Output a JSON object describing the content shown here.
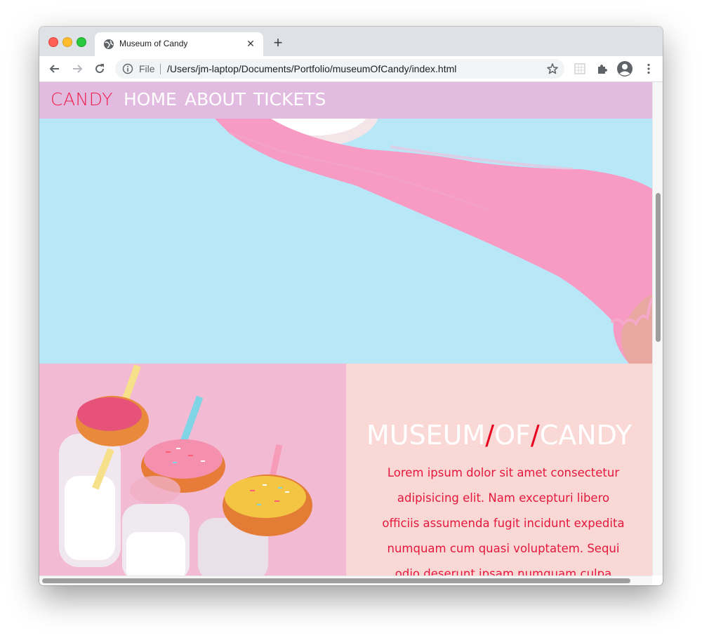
{
  "browser": {
    "tab_title": "Museum of Candy",
    "tab_close": "✕",
    "new_tab": "+",
    "url_scheme": "File",
    "url": "/Users/jm-laptop/Documents/Portfolio/museumOfCandy/index.html"
  },
  "page": {
    "nav": {
      "brand": "CANDY",
      "links": [
        "HOME",
        "ABOUT",
        "TICKETS"
      ]
    },
    "feature": {
      "title_parts": [
        "MUSEUM",
        "/",
        "OF",
        "/",
        "CANDY"
      ],
      "body": "Lorem ipsum dolor sit amet consectetur adipisicing elit. Nam excepturi libero officiis assumenda fugit incidunt expedita numquam cum quasi voluptatem. Sequi odio deserunt ipsam numquam culpa deleniti pariatur eos."
    }
  },
  "colors": {
    "nav_bg": "#e2bbe0",
    "brand": "#ee1f4d",
    "hero_bg": "#b8e8f8",
    "glove": "#f79ac4",
    "info_bg": "#f9d8d6",
    "body_text": "#e5183c",
    "slash": "#e8001e"
  },
  "icons": {
    "favicon": "globe-icon",
    "back": "back-arrow-icon",
    "forward": "forward-arrow-icon",
    "reload": "reload-icon",
    "info": "info-icon",
    "bookmark": "star-icon",
    "extension": "extension-grid-icon",
    "puzzle": "puzzle-icon",
    "profile": "profile-avatar-icon",
    "menu": "kebab-menu-icon"
  }
}
